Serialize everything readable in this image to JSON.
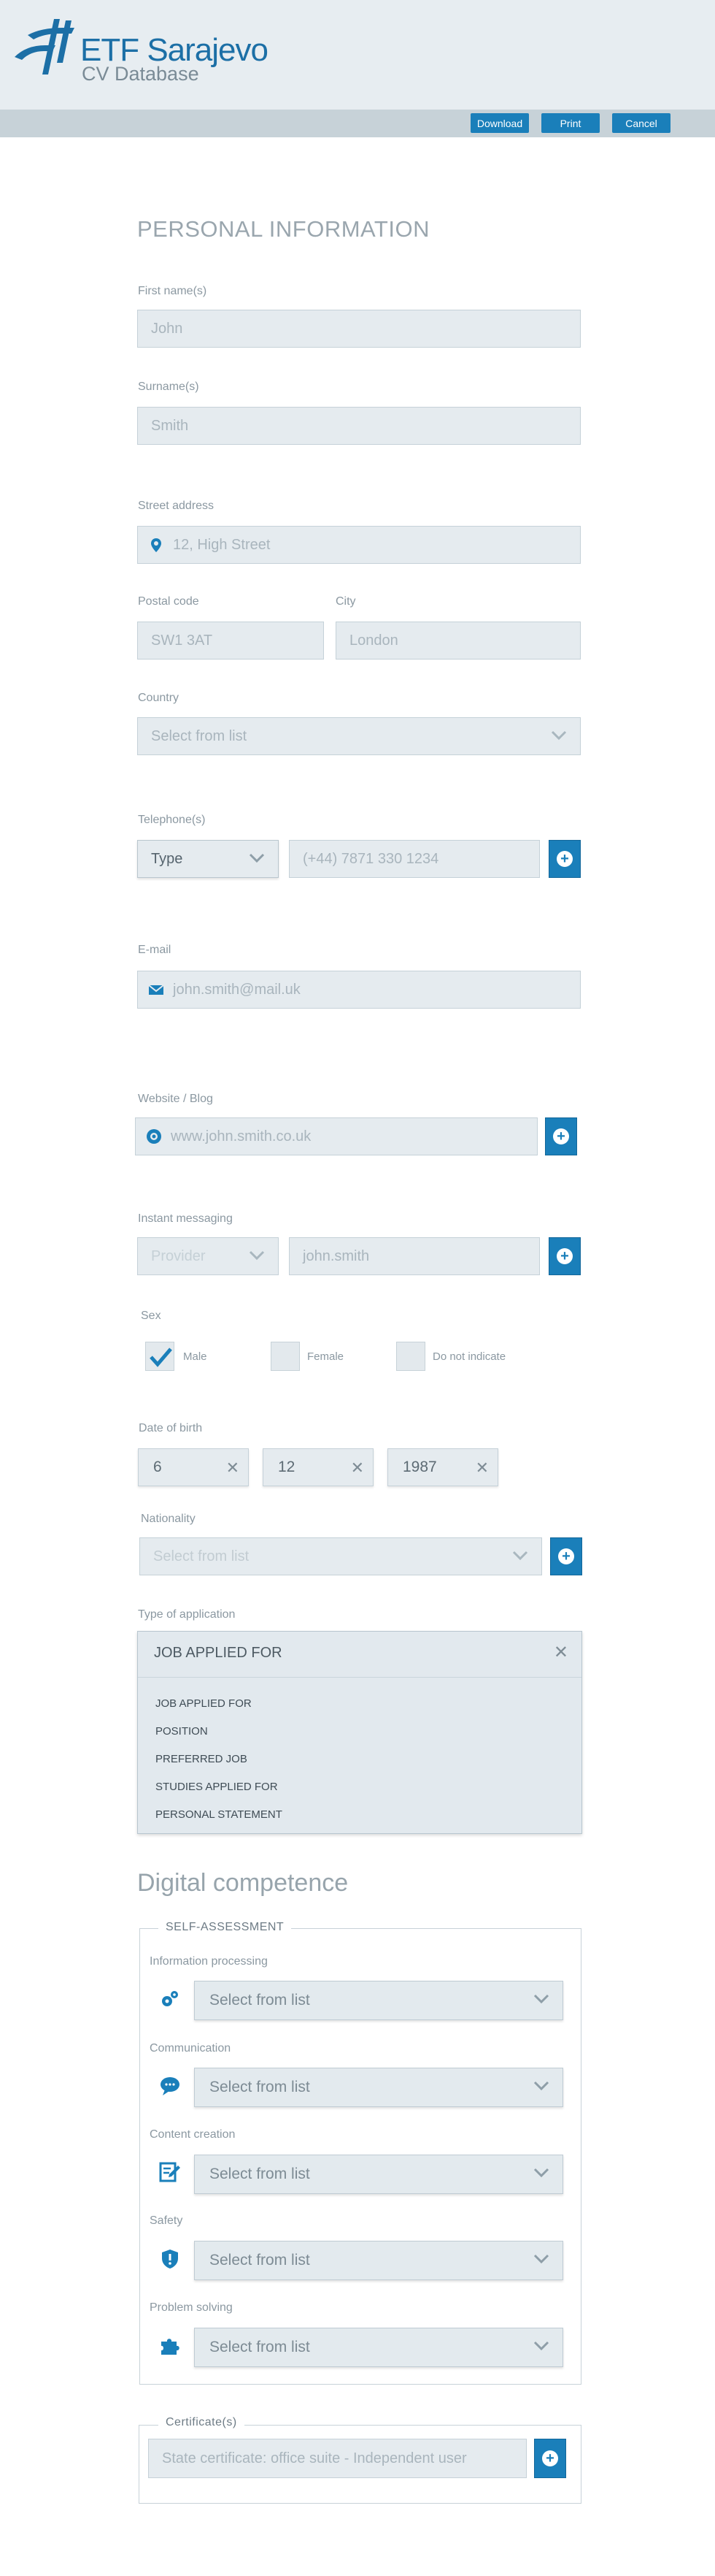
{
  "brand": {
    "title": "ETF Sarajevo",
    "subtitle": "CV Database",
    "color": "#1c6fa6"
  },
  "toolbar": {
    "download_label": "Download",
    "print_label": "Print",
    "cancel_label": "Cancel",
    "button_color": "#1a7fba"
  },
  "personal": {
    "section_title": "PERSONAL INFORMATION",
    "first_name": {
      "label": "First name(s)",
      "placeholder": "John"
    },
    "surname": {
      "label": "Surname(s)",
      "placeholder": "Smith"
    },
    "street": {
      "label": "Street address",
      "placeholder": "12, High Street",
      "icon": "location-pin-icon"
    },
    "postal": {
      "label": "Postal code",
      "placeholder": "SW1 3AT"
    },
    "city": {
      "label": "City",
      "placeholder": "London"
    },
    "country": {
      "label": "Country",
      "placeholder": "Select from list"
    },
    "telephone": {
      "label": "Telephone(s)",
      "type_value": "Type",
      "placeholder": "(+44) 7871 330 1234"
    },
    "email": {
      "label": "E-mail",
      "placeholder": "john.smith@mail.uk",
      "icon": "envelope-icon"
    },
    "website": {
      "label": "Website / Blog",
      "placeholder": "www.john.smith.co.uk",
      "icon": "globe-icon"
    },
    "im": {
      "label": "Instant messaging",
      "provider_placeholder": "Provider",
      "placeholder": "john.smith"
    },
    "sex": {
      "label": "Sex",
      "options": [
        {
          "label": "Male",
          "checked": true
        },
        {
          "label": "Female",
          "checked": false
        },
        {
          "label": "Do not indicate",
          "checked": false
        }
      ]
    },
    "dob": {
      "label": "Date of birth",
      "day": "6",
      "month": "12",
      "year": "1987"
    },
    "nationality": {
      "label": "Nationality",
      "placeholder": "Select from list"
    },
    "application": {
      "label": "Type of application",
      "selected": "JOB APPLIED FOR",
      "options": [
        "JOB APPLIED FOR",
        "POSITION",
        "PREFERRED JOB",
        "STUDIES APPLIED FOR",
        "PERSONAL STATEMENT"
      ]
    }
  },
  "digital": {
    "section_title": "Digital competence",
    "legend": "SELF-ASSESSMENT",
    "items": [
      {
        "label": "Information processing",
        "placeholder": "Select from list",
        "icon": "gears-icon"
      },
      {
        "label": "Communication",
        "placeholder": "Select from list",
        "icon": "speech-bubble-icon"
      },
      {
        "label": "Content creation",
        "placeholder": "Select from list",
        "icon": "edit-document-icon"
      },
      {
        "label": "Safety",
        "placeholder": "Select from list",
        "icon": "shield-icon"
      },
      {
        "label": "Problem solving",
        "placeholder": "Select from list",
        "icon": "puzzle-piece-icon"
      }
    ],
    "certificate": {
      "legend": "Certificate(s)",
      "placeholder": "State certificate: office suite - Independent user"
    }
  }
}
